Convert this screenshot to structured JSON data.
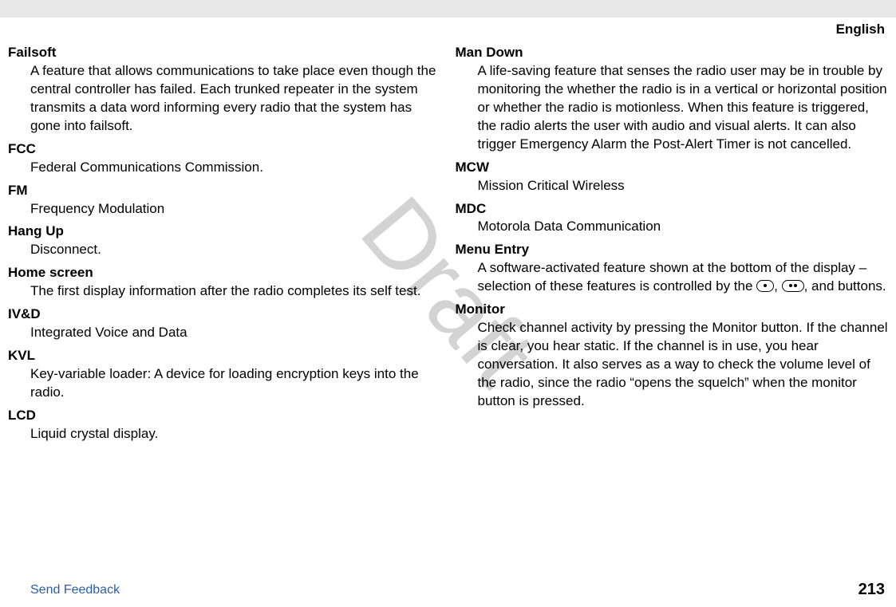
{
  "header": {
    "language": "English"
  },
  "watermark": "Draft",
  "left": {
    "items": [
      {
        "term": "Failsoft",
        "def": "A feature that allows communications to take place even though the central controller has failed. Each trunked repeater in the system transmits a data word informing every radio that the system has gone into failsoft."
      },
      {
        "term": "FCC",
        "def": "Federal Communications Commission."
      },
      {
        "term": "FM",
        "def": "Frequency Modulation"
      },
      {
        "term": "Hang Up",
        "def": "Disconnect."
      },
      {
        "term": "Home screen",
        "def": "The first display information after the radio completes its self test."
      },
      {
        "term": "IV&D",
        "def": "Integrated Voice and Data"
      },
      {
        "term": "KVL",
        "def": "Key-variable loader: A device for loading encryption keys into the radio."
      },
      {
        "term": "LCD",
        "def": "Liquid crystal display."
      }
    ]
  },
  "right": {
    "items": [
      {
        "term": "Man Down",
        "def": "A life-saving feature that senses the radio user may be in trouble by monitoring the whether the radio is in a vertical or horizontal position or whether the radio is motionless. When this feature is triggered, the radio alerts the user with audio and visual alerts. It can also trigger Emergency Alarm the Post-Alert Timer is not cancelled."
      },
      {
        "term": "MCW",
        "def": "Mission Critical Wireless"
      },
      {
        "term": "MDC",
        "def": "Motorola Data Communication"
      },
      {
        "term": "Menu Entry",
        "def_pre": "A software-activated feature shown at the bottom of the display – selection of these features is controlled by the ",
        "def_post": ", and buttons."
      },
      {
        "term": "Monitor",
        "def": "Check channel activity by pressing the Monitor button. If the channel is clear, you hear static. If the channel is in use, you hear conversation. It also serves as a way to check the volume level of the radio, since the radio “opens the squelch” when the monitor button is pressed."
      }
    ]
  },
  "footer": {
    "feedback": "Send Feedback",
    "page": "213"
  }
}
